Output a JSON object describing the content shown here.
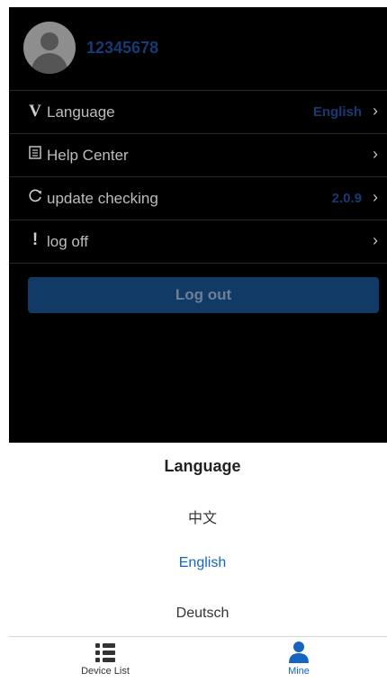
{
  "profile": {
    "username": "12345678"
  },
  "menu": {
    "language": {
      "label": "Language",
      "value": "English",
      "icon": "V"
    },
    "help": {
      "label": "Help Center",
      "icon": "document-icon"
    },
    "update": {
      "label": "update checking",
      "value": "2.0.9",
      "icon": "refresh-icon"
    },
    "logoff": {
      "label": "log off",
      "icon": "!"
    }
  },
  "logout_button": "Log out",
  "language_sheet": {
    "title": "Language",
    "options": [
      "中文",
      "English",
      "Deutsch"
    ],
    "selected": "English"
  },
  "tabbar": {
    "device_list": "Device List",
    "mine": "Mine"
  },
  "colors": {
    "accent": "#1565c0",
    "dark_bg": "#000000"
  }
}
